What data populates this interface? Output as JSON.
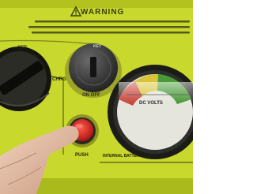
{
  "panel": {
    "warning_heading": "WARNING",
    "colors": {
      "housing": "#c7d62a",
      "key_switch": "#3a3a3a",
      "push_button": "#d81f1f",
      "gauge_red": "#c8483e",
      "gauge_yellow": "#d9c437",
      "gauge_green": "#4a9a3a"
    },
    "labels": {
      "off": "OFF",
      "chrg": "CHRG",
      "key": "KEY",
      "on_off": "ON OFF",
      "dc_volts": "DC VOLTS",
      "push": "PUSH",
      "battery_status": "INTERNAL BATTERY STATUS"
    },
    "icons": {
      "warning": "warning-triangle-icon"
    }
  }
}
